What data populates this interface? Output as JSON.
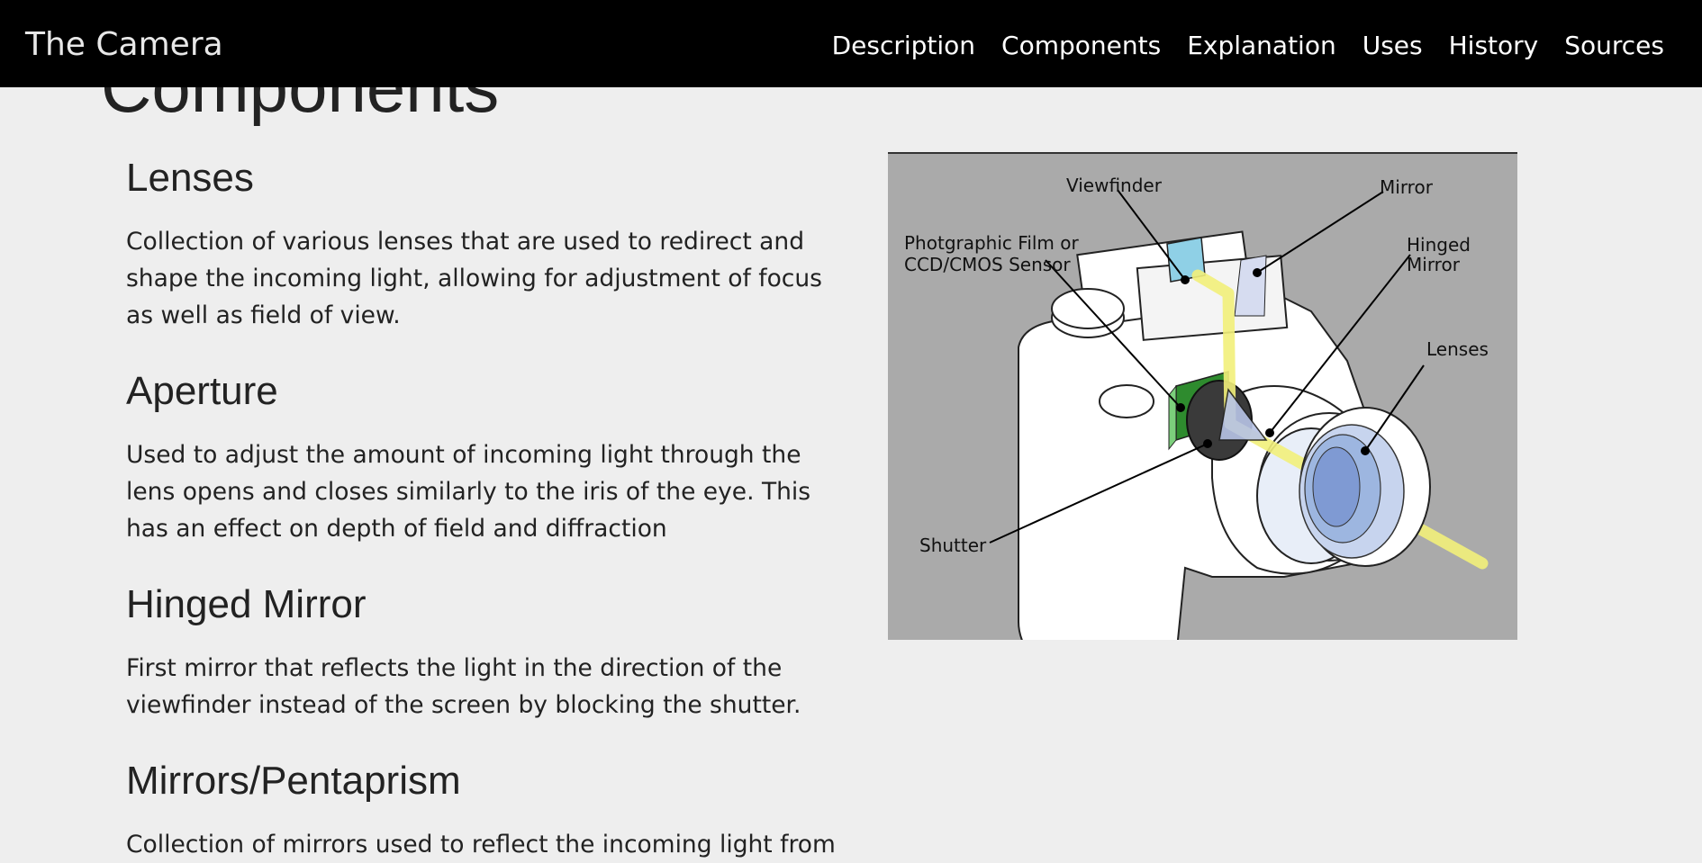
{
  "navbar": {
    "brand": "The Camera",
    "links": [
      "Description",
      "Components",
      "Explanation",
      "Uses",
      "History",
      "Sources"
    ]
  },
  "page": {
    "heading": "Components"
  },
  "sections": [
    {
      "title": "Lenses",
      "body": "Collection of various lenses that are used to redirect and shape the incoming light, allowing for adjustment of focus as well as field of view."
    },
    {
      "title": "Aperture",
      "body": "Used to adjust the amount of incoming light through the lens opens and closes similarly to the iris of the eye. This has an effect on depth of field and diffraction"
    },
    {
      "title": "Hinged Mirror",
      "body": "First mirror that reflects the light in the direction of the viewfinder instead of the screen by blocking the shutter."
    },
    {
      "title": "Mirrors/Pentaprism",
      "body": "Collection of mirrors used to reflect the incoming light from"
    }
  ],
  "diagram": {
    "labels": {
      "viewfinder": "Viewfinder",
      "mirror": "Mirror",
      "sensor_line1": "Photgraphic Film or",
      "sensor_line2": "CCD/CMOS Sensor",
      "hinged_line1": "Hinged",
      "hinged_line2": "Mirror",
      "lenses": "Lenses",
      "shutter": "Shutter"
    },
    "colors": {
      "background": "#aaaaaa",
      "light_beam": "#f2f07a",
      "sensor": "#2e8b2e",
      "viewfinder_glass": "#8fd0e6",
      "lens_glass": "#9db6e0"
    }
  }
}
